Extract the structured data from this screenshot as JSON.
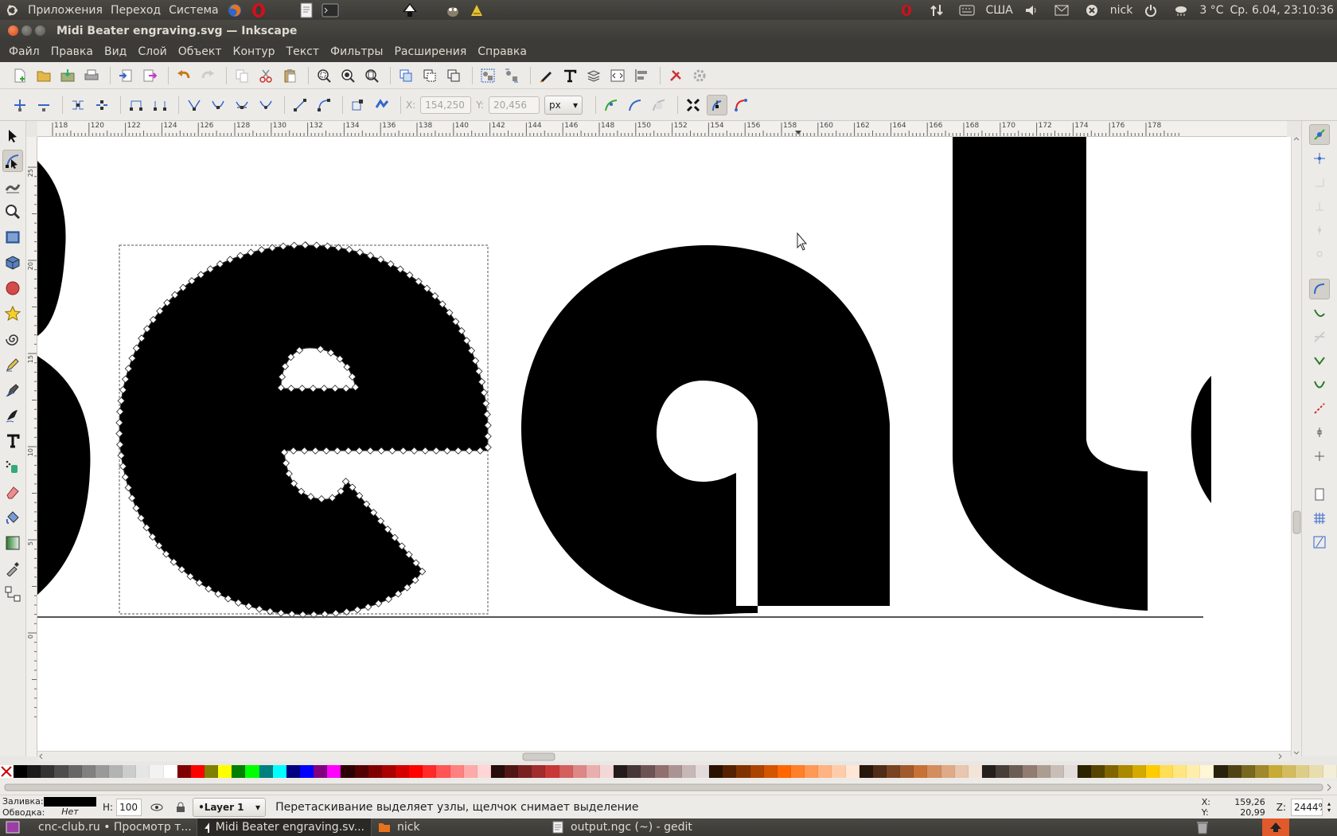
{
  "top_panel": {
    "menu_apps": "Приложения",
    "menu_places": "Переход",
    "menu_system": "Система",
    "keyboard_layout": "США",
    "user": "nick",
    "weather": "3 °C",
    "clock": "Ср. 6.04, 23:10:36"
  },
  "window": {
    "title": "Midi Beater engraving.svg — Inkscape"
  },
  "menubar": [
    "Файл",
    "Правка",
    "Вид",
    "Слой",
    "Объект",
    "Контур",
    "Текст",
    "Фильтры",
    "Расширения",
    "Справка"
  ],
  "node_toolbar": {
    "x_label": "X:",
    "x_value": "154,250",
    "y_label": "Y:",
    "y_value": "20,456",
    "unit": "px"
  },
  "ruler": {
    "h_labels": [
      "118",
      "120",
      "122",
      "124",
      "126",
      "128",
      "130",
      "132",
      "134",
      "136",
      "138",
      "140",
      "142",
      "144",
      "146",
      "148",
      "150",
      "152",
      "154",
      "156",
      "158",
      "160",
      "162",
      "164",
      "166",
      "168",
      "170",
      "172",
      "174",
      "176",
      "178"
    ],
    "v_labels": [
      "25",
      "20",
      "15",
      "10",
      "5",
      "0"
    ]
  },
  "palette": [
    "#000000",
    "#1a1a1a",
    "#333333",
    "#4d4d4d",
    "#666666",
    "#808080",
    "#999999",
    "#b3b3b3",
    "#cccccc",
    "#e6e6e6",
    "#f2f2f2",
    "#ffffff",
    "#800000",
    "#ff0000",
    "#808000",
    "#ffff00",
    "#008000",
    "#00ff00",
    "#008080",
    "#00ffff",
    "#000080",
    "#0000ff",
    "#800080",
    "#ff00ff",
    "#2b0000",
    "#550000",
    "#800000",
    "#aa0000",
    "#d40000",
    "#ff0000",
    "#ff2a2a",
    "#ff5555",
    "#ff8080",
    "#ffaaaa",
    "#ffd5d5",
    "#280b0b",
    "#501616",
    "#782121",
    "#a02c2c",
    "#c83737",
    "#d35f5f",
    "#de8787",
    "#e9afaf",
    "#f4d7d7",
    "#241c1c",
    "#483737",
    "#6c5353",
    "#916f6f",
    "#ac9393",
    "#c8b7b7",
    "#e3dbdb",
    "#2b1100",
    "#552200",
    "#803300",
    "#aa4400",
    "#d45500",
    "#ff6600",
    "#ff7f2a",
    "#ff9955",
    "#ffb380",
    "#ffccaa",
    "#ffe6d5",
    "#28170b",
    "#502d16",
    "#784421",
    "#a05a2c",
    "#c87137",
    "#d38d5f",
    "#deaa87",
    "#e9c6af",
    "#f4e3d7",
    "#241f1c",
    "#483e37",
    "#6c5d53",
    "#917c6f",
    "#ac9d93",
    "#c8beb7",
    "#e3dedb",
    "#2b2200",
    "#554400",
    "#806600",
    "#aa8800",
    "#d4aa00",
    "#ffcc00",
    "#ffdd55",
    "#ffe680",
    "#ffeeaa",
    "#fff6d5",
    "#28220b",
    "#504416",
    "#786721",
    "#a0892c",
    "#c8ab37",
    "#d3bc5f",
    "#decd87",
    "#e9ddaf",
    "#f4eed7"
  ],
  "status": {
    "fill_label": "Заливка:",
    "stroke_label": "Обводка:",
    "stroke_value": "Нет",
    "opacity_label": "Н:",
    "opacity_value": "100",
    "layer": "•Layer 1",
    "message": "Перетаскивание выделяет узлы, щелчок снимает выделение",
    "cursor_x_label": "X:",
    "cursor_x": "159,26",
    "cursor_y_label": "Y:",
    "cursor_y": "20,99",
    "zoom_label": "Z:",
    "zoom": "2444%"
  },
  "taskbar": {
    "items": [
      "cnc-club.ru • Просмотр т...",
      "Midi Beater engraving.sv...",
      "nick",
      "output.ngc (~) - gedit"
    ]
  },
  "colors": {
    "panel": "#3c3b37",
    "toolbar": "#edebe7",
    "accent": "#e05a2b",
    "node_blue": "#2a5bd7"
  }
}
